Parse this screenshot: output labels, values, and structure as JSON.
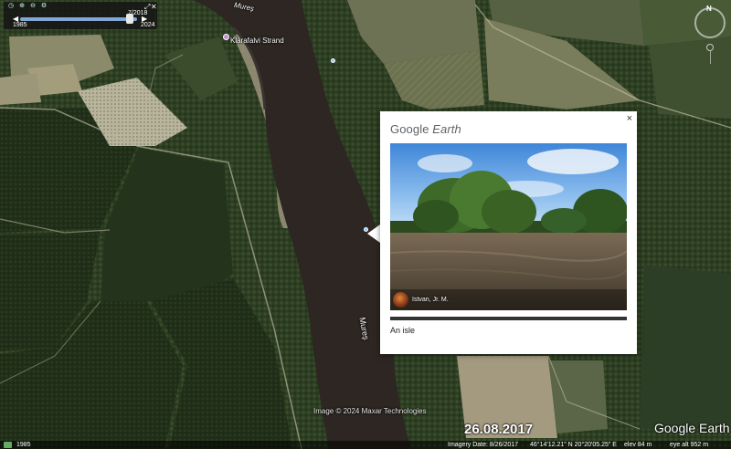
{
  "timeslider": {
    "start_year": "1985",
    "end_year": "2024",
    "current_date": "7/2018",
    "icons": [
      "clock-icon",
      "zoom-in-icon",
      "zoom-out-icon",
      "settings-icon"
    ]
  },
  "map": {
    "river_label_top": "Mureș",
    "river_label_bottom": "Mureș",
    "place_label": "Klárafalvi Strand",
    "copyright": "Image © 2024 Maxar Technologies",
    "date_overlay": "26.08.2017",
    "logo": "Google Earth"
  },
  "balloon": {
    "logo_brand": "Google",
    "logo_product": "Earth",
    "close_label": "×",
    "author": "Istvan, Jr. M.",
    "caption": "An isle"
  },
  "statusbar": {
    "year": "1985",
    "imagery_date": "Imagery Date: 8/26/2017",
    "coords": "46°14'12.21\" N   20°20'05.25\" E",
    "elevation": "elev   84 m",
    "eye_alt": "eye alt   952 m"
  }
}
